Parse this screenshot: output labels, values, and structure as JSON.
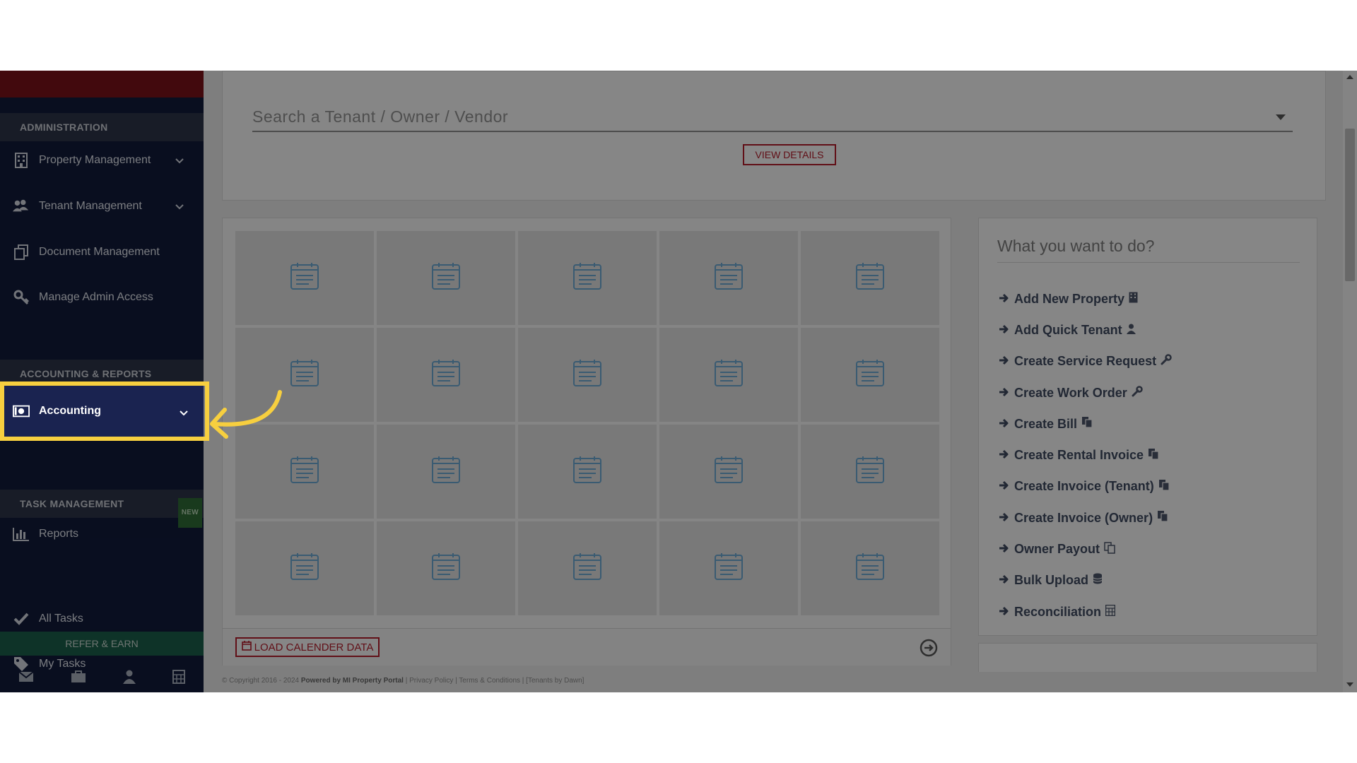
{
  "sidebar": {
    "sections": [
      {
        "label": "ADMINISTRATION"
      },
      {
        "label": "ACCOUNTING & REPORTS"
      },
      {
        "label": "TASK MANAGEMENT",
        "badge": "NEW"
      }
    ],
    "items": [
      {
        "label": "Property Management",
        "icon": "building-icon",
        "has_chevron": true
      },
      {
        "label": "Tenant Management",
        "icon": "users-icon",
        "has_chevron": true
      },
      {
        "label": "Document Management",
        "icon": "documents-icon",
        "has_chevron": false
      },
      {
        "label": "Manage Admin Access",
        "icon": "key-icon",
        "has_chevron": false
      },
      {
        "label": "Accounting",
        "icon": "money-icon",
        "has_chevron": true,
        "highlighted": true
      },
      {
        "label": "Reports",
        "icon": "bar-chart-icon",
        "has_chevron": false
      },
      {
        "label": "All Tasks",
        "icon": "check-icon",
        "has_chevron": false
      },
      {
        "label": "My Tasks",
        "icon": "tag-icon",
        "has_chevron": false
      }
    ],
    "refer_label": "REFER & EARN",
    "bottom_icons": [
      "envelope-icon",
      "briefcase-icon",
      "user-icon",
      "calculator-icon"
    ]
  },
  "search": {
    "placeholder": "Search a Tenant / Owner / Vendor",
    "view_details_label": "VIEW DETAILS"
  },
  "calendar": {
    "rows": 4,
    "cols": 5,
    "load_button_label": "LOAD CALENDER DATA"
  },
  "todo": {
    "title": "What you want to do?",
    "actions": [
      {
        "label": "Add New Property",
        "icon": "building-icon"
      },
      {
        "label": "Add Quick Tenant",
        "icon": "user-icon"
      },
      {
        "label": "Create Service Request",
        "icon": "wrench-icon"
      },
      {
        "label": "Create Work Order",
        "icon": "wrench-icon"
      },
      {
        "label": "Create Bill",
        "icon": "copy-icon"
      },
      {
        "label": "Create Rental Invoice",
        "icon": "copy-icon"
      },
      {
        "label": "Create Invoice (Tenant)",
        "icon": "copy-icon"
      },
      {
        "label": "Create Invoice (Owner)",
        "icon": "copy-icon"
      },
      {
        "label": "Owner Payout",
        "icon": "copy-outline-icon"
      },
      {
        "label": "Bulk Upload",
        "icon": "database-icon"
      },
      {
        "label": "Reconciliation",
        "icon": "calculator-icon"
      }
    ]
  },
  "footer": {
    "copyright": "© Copyright 2016 - 2024",
    "powered": "Powered by MI Property Portal",
    "links": "| Privacy Policy | Terms & Conditions |",
    "tag": "[Tenants by Dawn]"
  },
  "colors": {
    "sidebar_bg": "#111a3a",
    "brand_bar": "#781219",
    "accent_red": "#b11c2a",
    "highlight_yellow": "#f7cf3f",
    "calendar_icon_blue": "#6aa6cf"
  }
}
